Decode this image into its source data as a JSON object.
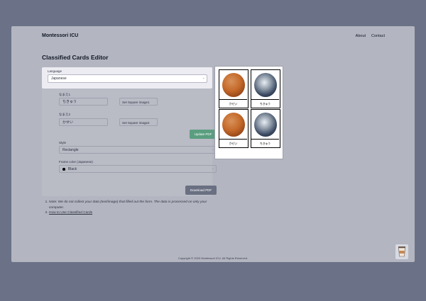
{
  "header": {
    "brand": "Montessori ICU",
    "nav": [
      "About",
      "Contact"
    ]
  },
  "page_title": "Classified Cards Editor",
  "form": {
    "language": {
      "label": "Language",
      "value": "Japanese"
    },
    "name1": {
      "label": "なまえ1",
      "value": "ちきゅう",
      "button": "Set Square image1"
    },
    "name2": {
      "label": "なまえ2",
      "value": "かせい",
      "button": "Set Square image2"
    },
    "update_button": "Update PDF",
    "style": {
      "label": "Style",
      "value": "Rectangle"
    },
    "frame_color": {
      "label": "Frame color (Japanese)",
      "value": "Black"
    },
    "download_button": "Download PDF"
  },
  "notes": [
    "Note: We do not collect your data (text/image) that filled out the form. The data is processed on only your computer.",
    "How to Use Classified Cards"
  ],
  "preview": {
    "captions": [
      "かせい",
      "ちきゅう",
      "かせい",
      "ちきゅう"
    ]
  },
  "footer": "Copyright © 2020 Montessori ICU. All Rights Reserved.",
  "icons": {
    "coffee": "coffee-cup-icon"
  },
  "colors": {
    "update": "#5a9e7f",
    "download": "#6a7082"
  }
}
